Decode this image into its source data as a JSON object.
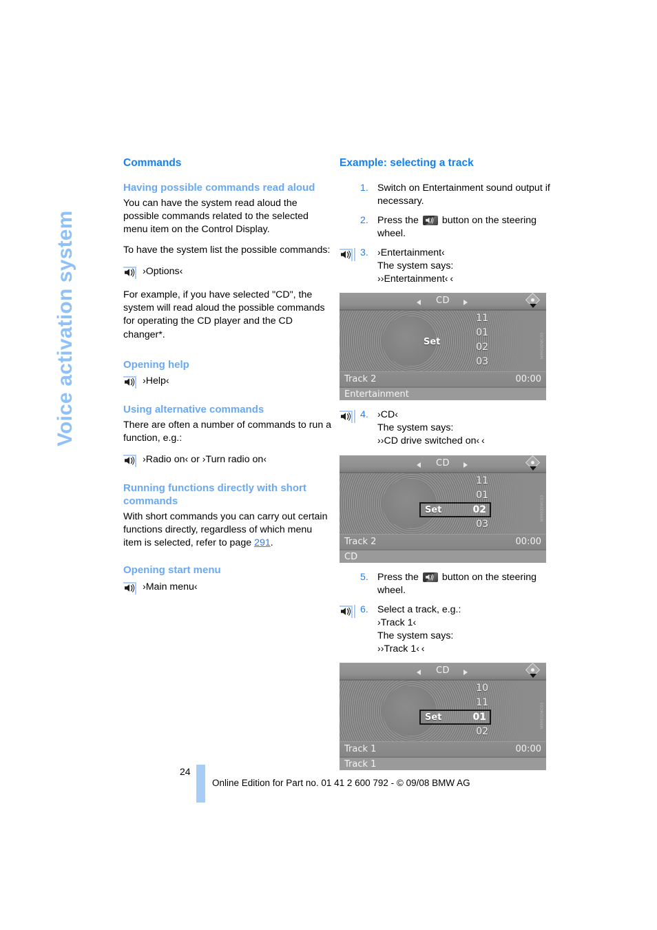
{
  "chapter_tab": {
    "label": "Voice activation system"
  },
  "left_column": {
    "section_title": "Commands",
    "blocks": {
      "read_aloud_heading": "Having possible commands read aloud",
      "read_aloud_p1": "You can have the system read aloud the possible commands related to the selected menu item on the Control Display.",
      "read_aloud_p2": "To have the system list the possible commands:",
      "options_command": "›Options‹",
      "read_aloud_p3": "For example, if you have selected \"CD\", the system will read aloud the possible commands for operating the CD player and the CD changer*.",
      "help_heading": "Opening help",
      "help_command": "›Help‹",
      "alt_heading": "Using alternative commands",
      "alt_p1": "There are often a number of commands to run a function, e.g.:",
      "alt_command": "›Radio on‹  or ›Turn radio on‹",
      "short_heading": "Running functions directly with short commands",
      "short_p1_a": "With short commands you can carry out certain functions directly, regardless of which menu item is selected, refer to page ",
      "short_p1_page": "291",
      "short_p1_b": ".",
      "start_heading": "Opening start menu",
      "start_command": "›Main menu‹"
    }
  },
  "right_column": {
    "section_title": "Example: selecting a track",
    "steps": [
      {
        "num": "1.",
        "lines": [
          "Switch on Entertainment sound output if necessary."
        ]
      },
      {
        "num": "2.",
        "prefix": "Press the ",
        "suffix": " button on the steering wheel."
      },
      {
        "num": "3.",
        "lines": [
          "›Entertainment‹",
          "The system says:",
          "››Entertainment‹ ‹"
        ]
      },
      {
        "num": "4.",
        "lines": [
          "›CD‹",
          "The system says:",
          "››CD drive switched on‹ ‹"
        ]
      },
      {
        "num": "5.",
        "prefix": "Press the ",
        "suffix": " button on the steering wheel."
      },
      {
        "num": "6.",
        "lines": [
          "Select a track, e.g.:",
          "›Track 1‹",
          "The system says:",
          "››Track 1‹ ‹"
        ]
      }
    ],
    "displays": [
      {
        "header_title": "CD",
        "numbers": [
          "11",
          "01",
          "02",
          "03"
        ],
        "set_label": "Set",
        "selected_index": -1,
        "track_name": "Track 2",
        "track_time": "00:00",
        "status": "Entertainment",
        "figure_code": "M99032MC03"
      },
      {
        "header_title": "CD",
        "numbers": [
          "11",
          "01",
          "02",
          "03"
        ],
        "set_label": "Set",
        "selected_index": 2,
        "track_name": "Track 2",
        "track_time": "00:00",
        "status": "CD",
        "figure_code": "M99032MC03"
      },
      {
        "header_title": "CD",
        "numbers": [
          "10",
          "11",
          "01",
          "02"
        ],
        "set_label": "Set",
        "selected_index": 2,
        "track_name": "Track 1",
        "track_time": "00:00",
        "status": "Track 1",
        "figure_code": "M99032MC03"
      }
    ]
  },
  "footer": {
    "page_number": "24",
    "online_edition": "Online Edition for Part no. 01 41 2 600 792 - © 09/08 BMW AG"
  },
  "colors": {
    "section_blue": "#1580f0",
    "sub_blue": "#6aa9f2",
    "tab_blue": "#8fc1f7",
    "rule_blue": "#a9cdf6",
    "link_blue": "#2a7de8"
  }
}
